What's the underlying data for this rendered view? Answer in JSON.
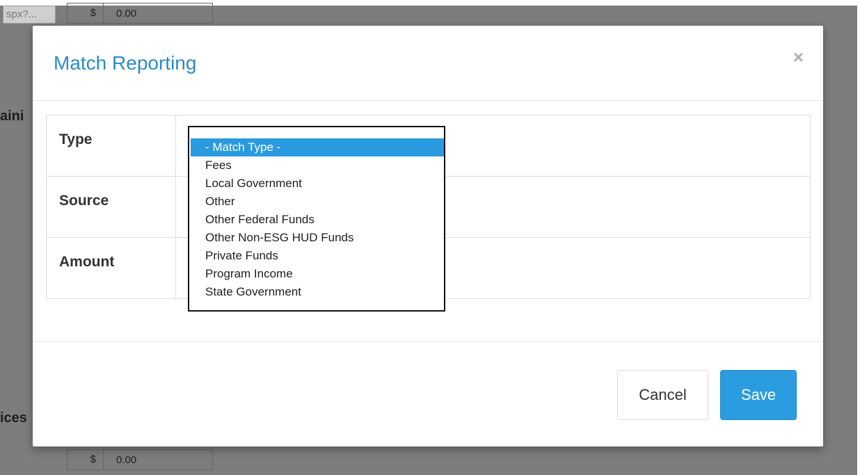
{
  "background": {
    "tooltip_fragment": "spx?...",
    "top_amount": {
      "currency": "$",
      "value": "0.00"
    },
    "bottom_amount": {
      "currency": "$",
      "value": "0.00"
    },
    "fragment_left_1": "aini",
    "fragment_left_2": "ices"
  },
  "modal": {
    "title": "Match Reporting",
    "close_label": "×",
    "fields": [
      {
        "label": "Type"
      },
      {
        "label": "Source"
      },
      {
        "label": "Amount"
      }
    ],
    "type_dropdown": {
      "selected": "- Match Type -",
      "options": [
        "- Match Type -",
        "Fees",
        "Local Government",
        "Other",
        "Other Federal Funds",
        "Other Non-ESG HUD Funds",
        "Private Funds",
        "Program Income",
        "State Government"
      ]
    },
    "footer": {
      "cancel_label": "Cancel",
      "save_label": "Save"
    }
  },
  "colors": {
    "title": "#2a8ac8",
    "save_button": "#2b9ce0",
    "selected_option": "#2a9ae0",
    "overlay": "#7d7d7d"
  }
}
